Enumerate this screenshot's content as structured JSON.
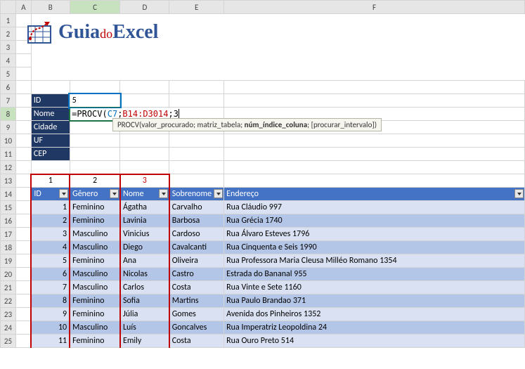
{
  "columns": [
    "A",
    "B",
    "C",
    "D",
    "E",
    "F"
  ],
  "logo": {
    "part1": "Guia",
    "part2": "do",
    "part3": "Excel"
  },
  "form": {
    "labels": {
      "id": "ID",
      "nome": "Nome",
      "cidade": "Cidade",
      "uf": "UF",
      "cep": "CEP"
    },
    "id_value": "5",
    "formula_raw": "=PROCV(C7;B14:D3014;3",
    "fn": "PROCV",
    "ref1": "C7",
    "ref2": "B14:D3014",
    "arg3": "3"
  },
  "tooltip": {
    "fn": "PROCV",
    "args": "(valor_procurado; matriz_tabela; ",
    "bold": "núm_índice_coluna",
    "rest": "; [procurar_intervalo])"
  },
  "col_numbers": {
    "c1": "1",
    "c2": "2",
    "c3": "3"
  },
  "headers": {
    "id": "ID",
    "genero": "Gênero",
    "nome": "Nome",
    "sobrenome": "Sobrenome",
    "endereco": "Endereço"
  },
  "rows": [
    {
      "id": "1",
      "genero": "Feminino",
      "nome": "Ágatha",
      "sobrenome": "Carvalho",
      "endereco": "Rua Cláudio 997"
    },
    {
      "id": "2",
      "genero": "Feminino",
      "nome": "Lavinia",
      "sobrenome": "Barbosa",
      "endereco": "Rua Grécia 1740"
    },
    {
      "id": "3",
      "genero": "Masculino",
      "nome": "Vinicius",
      "sobrenome": "Cardoso",
      "endereco": "Rua Álvaro Esteves 1796"
    },
    {
      "id": "4",
      "genero": "Masculino",
      "nome": "Diego",
      "sobrenome": "Cavalcanti",
      "endereco": "Rua Cinquenta e Seis 1990"
    },
    {
      "id": "5",
      "genero": "Feminino",
      "nome": "Ana",
      "sobrenome": "Oliveira",
      "endereco": "Rua Professora Maria Cleusa Milléo Romano 1354"
    },
    {
      "id": "6",
      "genero": "Masculino",
      "nome": "Nicolas",
      "sobrenome": "Castro",
      "endereco": "Estrada do Bananal 955"
    },
    {
      "id": "7",
      "genero": "Masculino",
      "nome": "Carlos",
      "sobrenome": "Costa",
      "endereco": "Rua Vinte e Sete 1160"
    },
    {
      "id": "8",
      "genero": "Feminino",
      "nome": "Sofia",
      "sobrenome": "Martins",
      "endereco": "Rua Paulo Brandao 371"
    },
    {
      "id": "9",
      "genero": "Feminino",
      "nome": "Júlia",
      "sobrenome": "Gomes",
      "endereco": "Avenida dos Pinheiros 1352"
    },
    {
      "id": "10",
      "genero": "Masculino",
      "nome": "Luís",
      "sobrenome": "Goncalves",
      "endereco": "Rua Imperatriz Leopoldina 24"
    },
    {
      "id": "11",
      "genero": "Feminino",
      "nome": "Emily",
      "sobrenome": "Costa",
      "endereco": "Rua Ouro Preto 514"
    }
  ]
}
